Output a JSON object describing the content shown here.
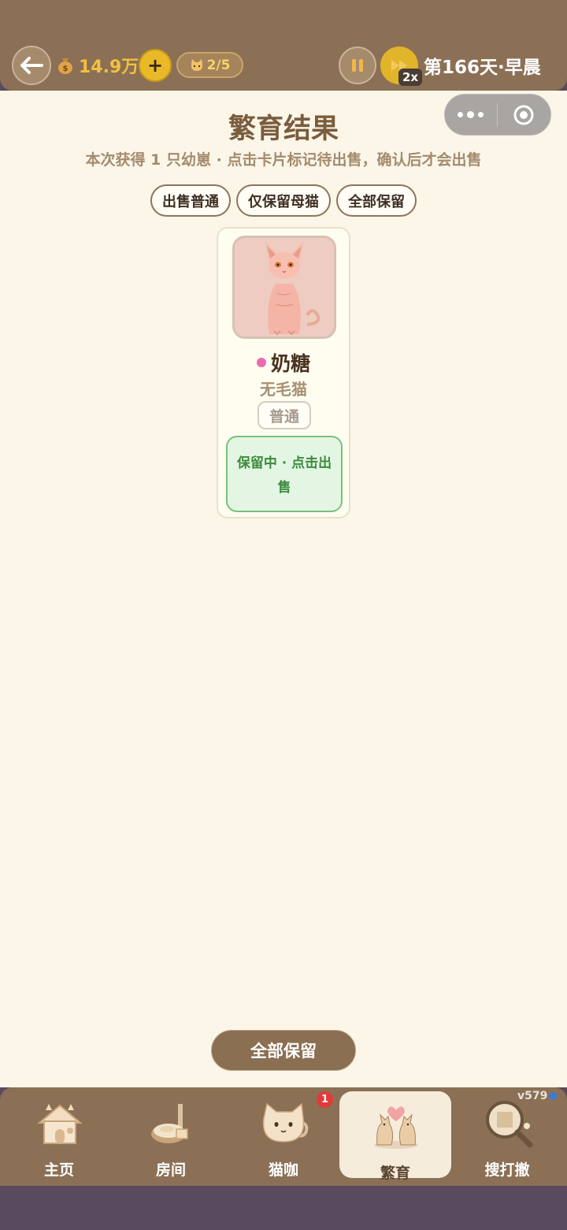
{
  "topbar": {
    "money": "14.9万",
    "cat_count": "2/5",
    "speed": "2x",
    "day": "第166天·早晨"
  },
  "header": {
    "title": "繁育结果",
    "subtitle": "本次获得 1 只幼崽 · 点击卡片标记待出售，确认后才会出售"
  },
  "filters": [
    {
      "label": "出售普通"
    },
    {
      "label": "仅保留母猫"
    },
    {
      "label": "全部保留"
    }
  ],
  "kitten": {
    "name": "奶糖",
    "breed": "无毛猫",
    "rarity": "普通",
    "gender_color": "#ec6ab0",
    "action": "保留中 · 点击出售"
  },
  "footer_button": "全部保留",
  "nav": {
    "items": [
      {
        "label": "主页",
        "icon": "house-icon"
      },
      {
        "label": "房间",
        "icon": "room-icon"
      },
      {
        "label": "猫咖",
        "icon": "cat-cafe-icon",
        "badge": "1"
      },
      {
        "label": "繁育",
        "icon": "breeding-icon",
        "active": true
      },
      {
        "label": "搜打撤",
        "icon": "magnifier-icon"
      }
    ],
    "version": "v579"
  }
}
